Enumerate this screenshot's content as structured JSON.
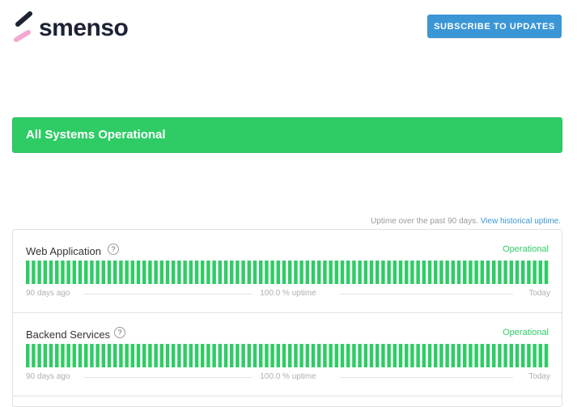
{
  "brand": {
    "name": "smenso",
    "icon": "smenso-logo-icon"
  },
  "header": {
    "subscribe_label": "SUBSCRIBE TO UPDATES"
  },
  "banner": {
    "text": "All Systems Operational",
    "color": "#2fcc66"
  },
  "uptime_note": {
    "text": "Uptime over the past 90 days.",
    "link": "View historical uptime."
  },
  "components": [
    {
      "name": "Web Application",
      "status": "Operational",
      "help_icon": "question-circle-icon",
      "bars": 90,
      "bar_color": "#2fcc66",
      "legend": {
        "start": "90 days ago",
        "uptime": "100.0 % uptime",
        "end": "Today"
      }
    },
    {
      "name": "Backend Services",
      "status": "Operational",
      "help_icon": "question-circle-icon",
      "bars": 90,
      "bar_color": "#2fcc66",
      "legend": {
        "start": "90 days ago",
        "uptime": "100.0 % uptime",
        "end": "Today"
      }
    }
  ]
}
